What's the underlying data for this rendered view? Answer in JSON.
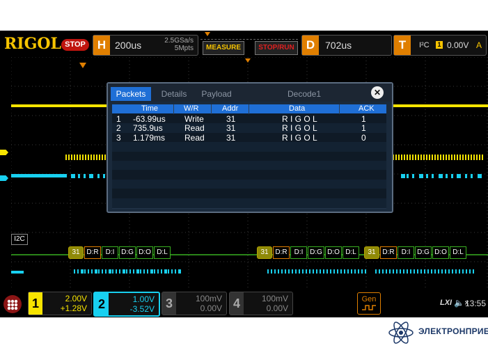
{
  "brand": {
    "logo": "RIGOL",
    "run_state": "STOP"
  },
  "horizontal": {
    "letter": "H",
    "timebase": "200us",
    "sample_rate": "2.5GSa/s",
    "memory_depth": "5Mpts"
  },
  "buttons": {
    "measure": "MEASURE",
    "stop_run": "STOP/RUN"
  },
  "delay": {
    "letter": "D",
    "value": "702us"
  },
  "trigger": {
    "letter": "T",
    "protocol": "I²C",
    "source": "1",
    "level": "0.00V",
    "mode": "A"
  },
  "decode_window": {
    "tabs": [
      "Packets",
      "Details",
      "Payload"
    ],
    "active_tab": "Packets",
    "title": "Decode1",
    "close_symbol": "✕",
    "columns": [
      "Time",
      "W/R",
      "Addr",
      "Data",
      "ACK"
    ],
    "rows": [
      {
        "index": "1",
        "time": "-63.99us",
        "wr": "Write",
        "addr": "31",
        "data": "R I G O L",
        "ack": "1"
      },
      {
        "index": "2",
        "time": "735.9us",
        "wr": "Read",
        "addr": "31",
        "data": "R I G O L",
        "ack": "1"
      },
      {
        "index": "3",
        "time": "1.179ms",
        "wr": "Read",
        "addr": "31",
        "data": "R I G O L",
        "ack": "0"
      }
    ]
  },
  "bus_label": "I2C",
  "bus_packets": [
    {
      "group": [
        {
          "type": "addr",
          "text": "31"
        },
        {
          "type": "dr",
          "text": "D:R"
        },
        {
          "type": "data",
          "text": "D:I"
        },
        {
          "type": "data",
          "text": "D:G"
        },
        {
          "type": "data",
          "text": "D:O"
        },
        {
          "type": "data",
          "text": "D:L"
        }
      ]
    },
    {
      "group": [
        {
          "type": "addr",
          "text": "31"
        },
        {
          "type": "dr",
          "text": "D:R"
        },
        {
          "type": "data",
          "text": "D:I"
        },
        {
          "type": "data",
          "text": "D:G"
        },
        {
          "type": "data",
          "text": "D:O"
        },
        {
          "type": "data",
          "text": "D:L"
        }
      ]
    },
    {
      "group": [
        {
          "type": "addr",
          "text": "31"
        },
        {
          "type": "dr",
          "text": "D:R"
        },
        {
          "type": "data",
          "text": "D:I"
        },
        {
          "type": "data",
          "text": "D:G"
        },
        {
          "type": "data",
          "text": "D:O"
        },
        {
          "type": "data",
          "text": "D:L"
        }
      ]
    }
  ],
  "channels": [
    {
      "num": "1",
      "scale": "2.00V",
      "offset": "+1.28V",
      "color": "#f7e400",
      "active": false
    },
    {
      "num": "2",
      "scale": "1.00V",
      "offset": "-3.52V",
      "color": "#18d0f0",
      "active": true
    },
    {
      "num": "3",
      "scale": "100mV",
      "offset": "0.00V",
      "color": "#888888",
      "active": false
    },
    {
      "num": "4",
      "scale": "100mV",
      "offset": "0.00V",
      "color": "#888888",
      "active": false
    }
  ],
  "gen_label": "Gen",
  "status": {
    "lxi": "LXI",
    "speaker": "🔈×",
    "time": "13:55"
  },
  "footer": {
    "company": "ЭЛЕКТРОНПРИБОР"
  },
  "colors": {
    "ch1": "#f7e400",
    "ch2": "#18d0f0",
    "bus": "#39b020",
    "accent": "#e07f00",
    "decode_tab": "#1f6fd6"
  }
}
